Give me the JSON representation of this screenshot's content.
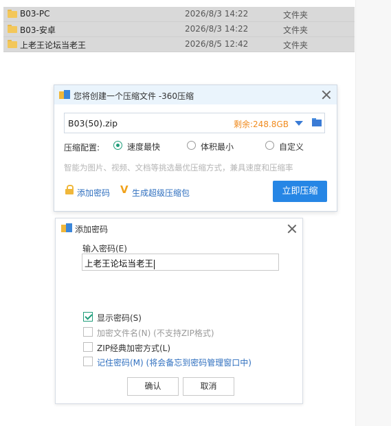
{
  "files": [
    {
      "name": "B03-PC",
      "date": "2026/8/3 14:22",
      "type": "文件夹"
    },
    {
      "name": "B03-安卓",
      "date": "2026/8/3 14:22",
      "type": "文件夹"
    },
    {
      "name": "上老王论坛当老王",
      "date": "2026/8/5 12:42",
      "type": "文件夹"
    }
  ],
  "compress_dialog": {
    "title": "您将创建一个压缩文件 -360压缩",
    "filename": "B03(50).zip",
    "free_space": "剩余:248.8GB",
    "config_label": "压缩配置:",
    "options": [
      "速度最快",
      "体积最小",
      "自定义"
    ],
    "selected_option": "速度最快",
    "hint": "智能为图片、视频、文档等挑选最优压缩方式，兼具速度和压缩率",
    "add_password": "添加密码",
    "super_package": "生成超级压缩包",
    "compress_button": "立即压缩"
  },
  "password_dialog": {
    "title": "添加密码",
    "input_label": "输入密码(E)",
    "password_value": "上老王论坛当老王",
    "checkboxes": [
      {
        "label": "显示密码(S)",
        "checked": true
      },
      {
        "label": "加密文件名(N) (不支持ZIP格式)",
        "checked": false
      },
      {
        "label": "ZIP经典加密方式(L)",
        "checked": false
      },
      {
        "label": "记住密码(M) (将会备忘到密码管理窗口中)",
        "checked": false
      }
    ],
    "ok_button": "确认",
    "cancel_button": "取消"
  },
  "colors": {
    "accent": "#2686e5",
    "selection_row": "#d9d9d9",
    "free_space": "#f08a1c",
    "check_green": "#1f9d7a",
    "link_blue": "#2f6fbf"
  }
}
